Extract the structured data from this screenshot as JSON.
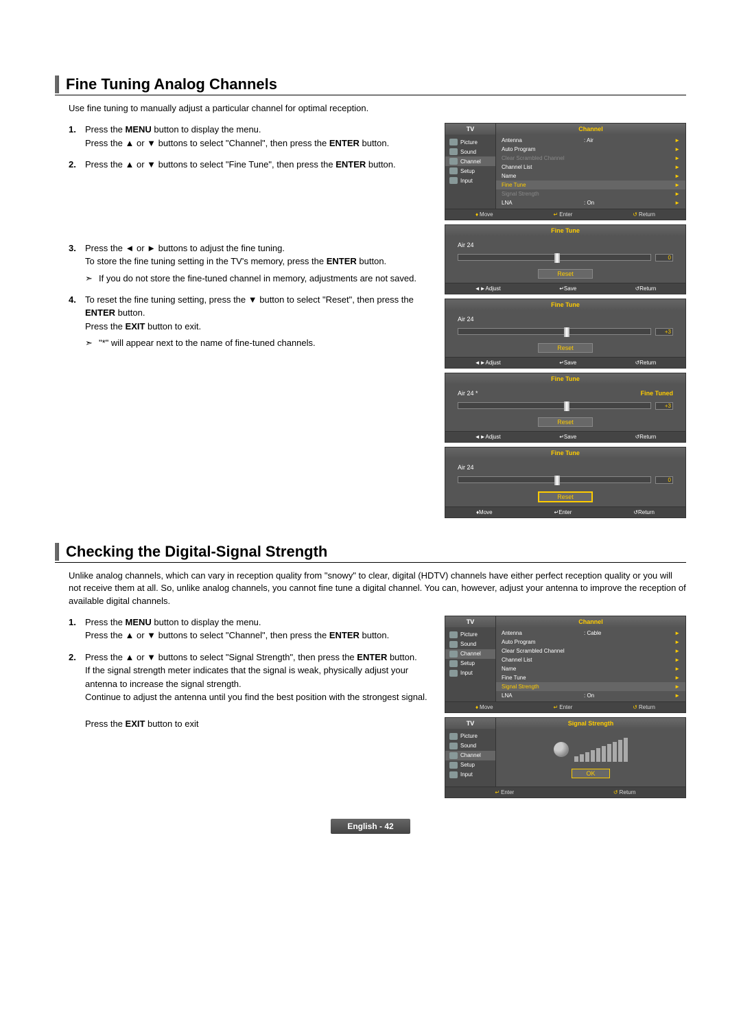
{
  "section1": {
    "title": "Fine Tuning Analog Channels",
    "intro": "Use fine tuning to manually adjust a particular channel for optimal reception.",
    "steps": {
      "s1a": "Press the ",
      "s1b": " button to display the menu.",
      "s1c": "Press the ▲ or ▼ buttons to select \"Channel\", then press the ",
      "s1d": " button.",
      "s2a": "Press the ▲ or ▼ buttons to select \"Fine Tune\", then press the ",
      "s2b": " button.",
      "s3a": "Press the ◄ or ► buttons to adjust the fine tuning.",
      "s3b": "To store the fine tuning setting in the TV's memory, press the ",
      "s3c": " button.",
      "s3note": "If you do not store the fine-tuned channel in memory, adjustments are not saved.",
      "s4a": "To reset the fine tuning setting, press the ▼ button to select \"Reset\", then press the ",
      "s4b": " button.",
      "s4c": "Press the ",
      "s4d": " button to exit.",
      "s4note": "\"*\" will appear next to the name of fine-tuned channels."
    },
    "bold": {
      "menu": "MENU",
      "enter": "ENTER",
      "exit": "EXIT"
    }
  },
  "section2": {
    "title": "Checking the Digital-Signal Strength",
    "intro": "Unlike analog channels, which can vary in reception quality from \"snowy\" to clear, digital (HDTV) channels have either perfect reception quality or you will not receive them at all. So, unlike analog channels, you cannot fine tune a digital channel. You can, however, adjust your antenna to improve the reception of available digital channels.",
    "steps": {
      "s1a": "Press the ",
      "s1b": " button to display the menu.",
      "s1c": "Press the ▲ or ▼ buttons to select \"Channel\", then press the ",
      "s1d": " button.",
      "s2a": "Press the ▲ or ▼ buttons to select \"Signal Strength\", then press the ",
      "s2b": " button.",
      "s2c": "If the signal strength meter indicates that the signal is weak, physically adjust your antenna to increase the signal strength.",
      "s2d": "Continue to adjust the antenna until you find the best position with the strongest signal.",
      "s2e": "Press the ",
      "s2f": " button to exit"
    }
  },
  "osd": {
    "tv": "TV",
    "channel": "Channel",
    "sidebar": [
      "Picture",
      "Sound",
      "Channel",
      "Setup",
      "Input"
    ],
    "menu1": [
      {
        "label": "Antenna",
        "value": ": Air",
        "arrow": "►"
      },
      {
        "label": "Auto Program",
        "value": "",
        "arrow": "►"
      },
      {
        "label": "Clear Scrambled Channel",
        "value": "",
        "arrow": "►",
        "dim": true
      },
      {
        "label": "Channel List",
        "value": "",
        "arrow": "►"
      },
      {
        "label": "Name",
        "value": "",
        "arrow": "►"
      },
      {
        "label": "Fine Tune",
        "value": "",
        "arrow": "►",
        "hl": true
      },
      {
        "label": "Signal Strength",
        "value": "",
        "arrow": "►",
        "dim": true
      },
      {
        "label": "LNA",
        "value": ": On",
        "arrow": "►"
      }
    ],
    "menu2": [
      {
        "label": "Antenna",
        "value": ": Cable",
        "arrow": "►"
      },
      {
        "label": "Auto Program",
        "value": "",
        "arrow": "►"
      },
      {
        "label": "Clear Scrambled Channel",
        "value": "",
        "arrow": "►"
      },
      {
        "label": "Channel List",
        "value": "",
        "arrow": "►"
      },
      {
        "label": "Name",
        "value": "",
        "arrow": "►"
      },
      {
        "label": "Fine Tune",
        "value": "",
        "arrow": "►"
      },
      {
        "label": "Signal Strength",
        "value": "",
        "arrow": "►",
        "hl": true
      },
      {
        "label": "LNA",
        "value": ": On",
        "arrow": "►"
      }
    ],
    "footerMove": "Move",
    "footerEnter": "Enter",
    "footerReturn": "Return",
    "footerAdjust": "Adjust",
    "footerSave": "Save",
    "ft": {
      "title": "Fine Tune",
      "reset": "Reset",
      "p1": {
        "ch": "Air 24",
        "val": "0",
        "pos": 50,
        "resetSel": false,
        "badge": ""
      },
      "p2": {
        "ch": "Air 24",
        "val": "+3",
        "pos": 55,
        "resetSel": false,
        "badge": ""
      },
      "p3": {
        "ch": "Air 24  *",
        "val": "+3",
        "pos": 55,
        "resetSel": false,
        "badge": "Fine Tuned"
      },
      "p4": {
        "ch": "Air 24",
        "val": "0",
        "pos": 50,
        "resetSel": true,
        "badge": ""
      }
    },
    "sig": {
      "title": "Signal Strength",
      "ok": "OK"
    }
  },
  "pagefoot": "English - 42"
}
